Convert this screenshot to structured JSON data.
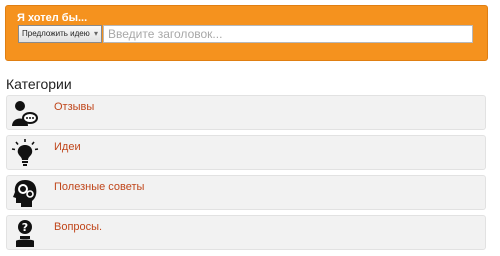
{
  "suggest_panel": {
    "title": "Я хотел бы...",
    "type_select": {
      "selected": "Предложить идею"
    },
    "title_input": {
      "placeholder": "Введите заголовок..."
    }
  },
  "categories": {
    "heading": "Категории",
    "items": [
      {
        "label": "Отзывы",
        "icon": "speech-bubble-person-icon"
      },
      {
        "label": "Идеи",
        "icon": "light-bulb-icon"
      },
      {
        "label": "Полезные советы",
        "icon": "head-gears-icon"
      },
      {
        "label": "Вопросы.",
        "icon": "question-person-icon"
      }
    ]
  },
  "colors": {
    "panel_background": "#f5921e",
    "link_color": "#c0461b",
    "item_background": "#f2f2f2"
  }
}
